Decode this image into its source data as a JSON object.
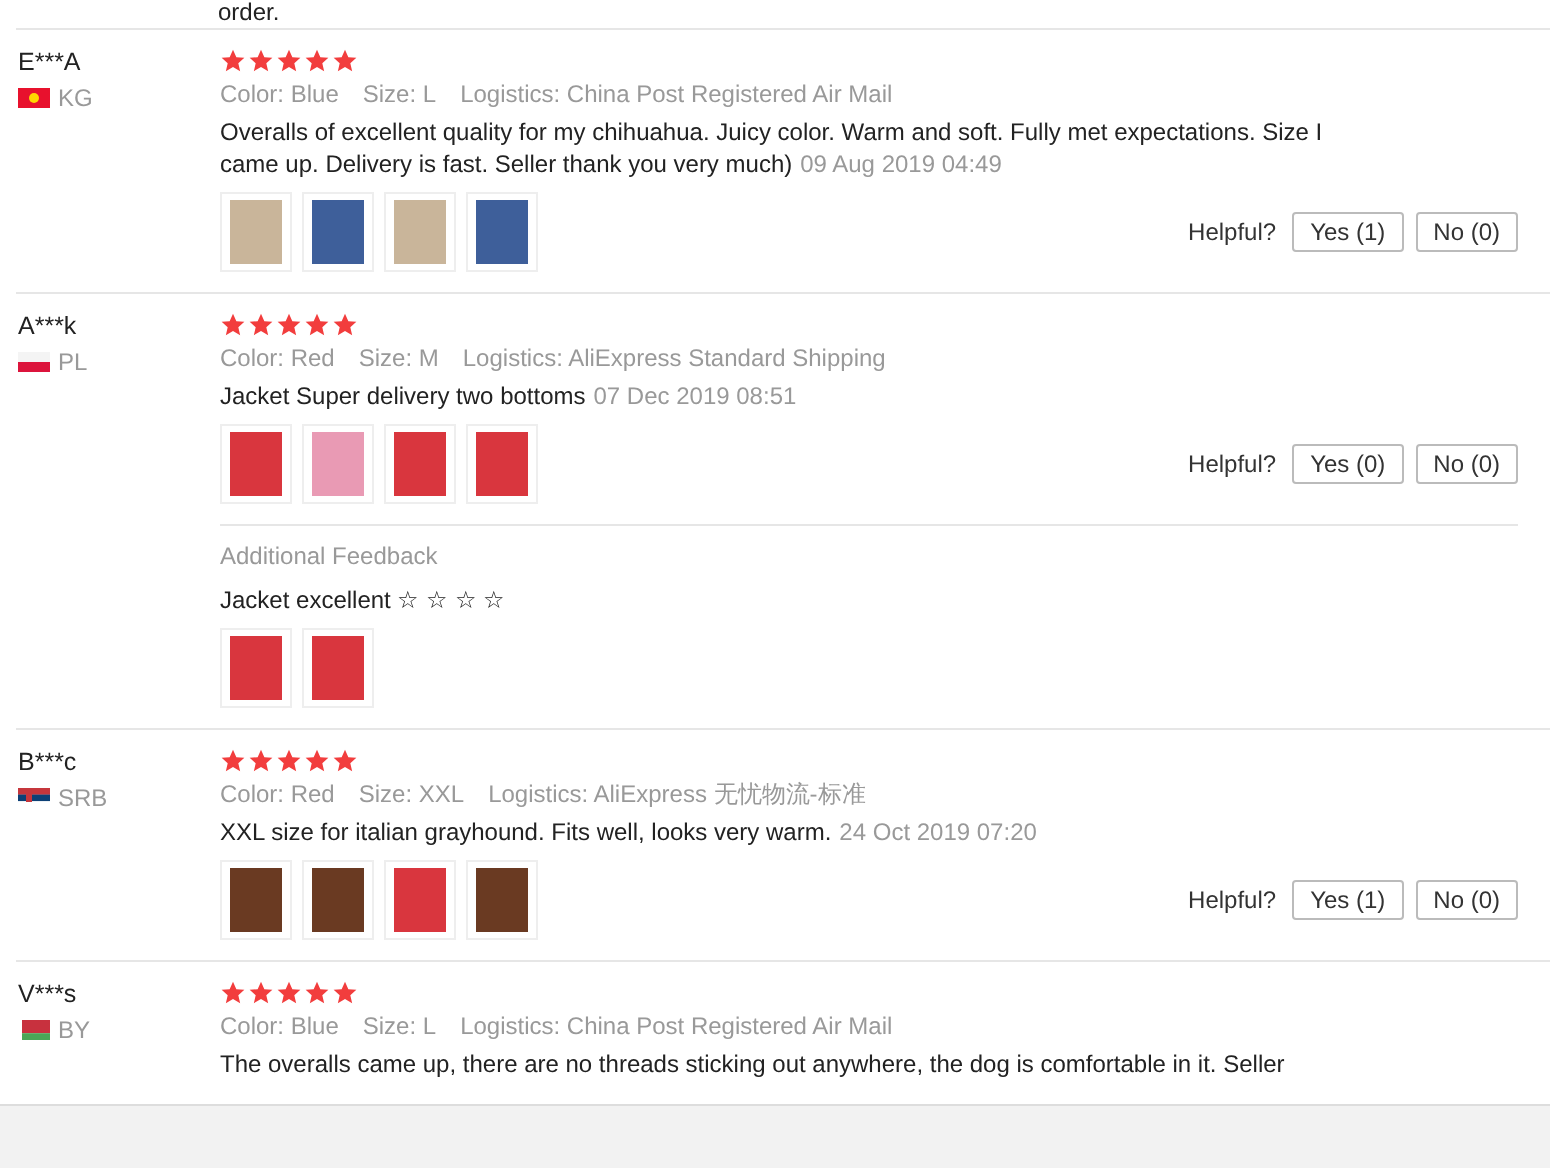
{
  "previous_review_tail": "order.",
  "reviews": [
    {
      "name": "E***A",
      "flag": {
        "kind": "kg"
      },
      "country": "KG",
      "stars": 5,
      "color_option": "Color: Blue",
      "size": "Size: L",
      "logistics": "Logistics: China Post Registered Air Mail",
      "text": "Overalls of excellent quality for my chihuahua. Juicy color. Warm and soft. Fully met expectations. Size I came up. Delivery is fast. Seller thank you very much)",
      "date": "09 Aug 2019 04:49",
      "photos": [
        {
          "kind": "beige"
        },
        {
          "kind": "blue"
        },
        {
          "kind": "beige"
        },
        {
          "kind": "blue"
        }
      ],
      "helpful_label": "Helpful?",
      "yes": "Yes (1)",
      "no": "No (0)"
    },
    {
      "name": "A***k",
      "flag": {
        "kind": "pl"
      },
      "country": "PL",
      "stars": 5,
      "color_option": "Color: Red",
      "size": "Size: M",
      "logistics": "Logistics: AliExpress Standard Shipping",
      "text": "Jacket Super delivery two bottoms",
      "date": "07 Dec 2019 08:51",
      "photos": [
        {
          "kind": "red"
        },
        {
          "kind": "pink"
        },
        {
          "kind": "red"
        },
        {
          "kind": "red"
        }
      ],
      "helpful_label": "Helpful?",
      "yes": "Yes (0)",
      "no": "No (0)",
      "additional": {
        "label": "Additional Feedback",
        "text": "Jacket excellent ☆ ☆ ☆ ☆",
        "photos": [
          {
            "kind": "red"
          },
          {
            "kind": "red"
          }
        ]
      }
    },
    {
      "name": "B***c",
      "flag": {
        "kind": "srb"
      },
      "country": "SRB",
      "stars": 5,
      "color_option": "Color: Red",
      "size": "Size: XXL",
      "logistics": "Logistics: AliExpress 无忧物流-标准",
      "text": "XXL size for italian grayhound. Fits well, looks very warm.",
      "date": "24 Oct 2019 07:20",
      "photos": [
        {
          "kind": "dark"
        },
        {
          "kind": "dark"
        },
        {
          "kind": "red"
        },
        {
          "kind": "dark"
        }
      ],
      "helpful_label": "Helpful?",
      "yes": "Yes (1)",
      "no": "No (0)"
    },
    {
      "name": "V***s",
      "flag": {
        "kind": "by"
      },
      "country": "BY",
      "stars": 5,
      "color_option": "Color: Blue",
      "size": "Size: L",
      "logistics": "Logistics: China Post Registered Air Mail",
      "text": "The overalls came up, there are no threads sticking out anywhere, the dog is comfortable in it. Seller"
    }
  ]
}
